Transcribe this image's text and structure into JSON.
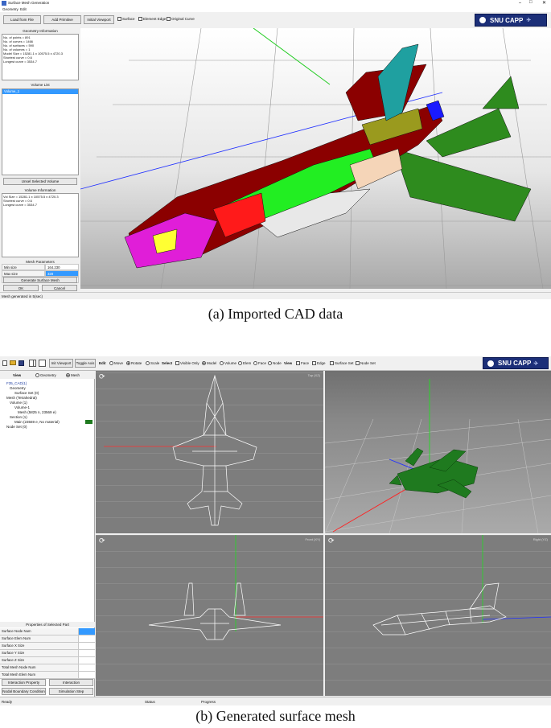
{
  "top": {
    "window_title": "Surface Mesh Generation",
    "menu": [
      "Geometry",
      "Edit"
    ],
    "window_controls": [
      "–",
      "□",
      "✕"
    ],
    "toolbar": {
      "load_file": "Load from File",
      "add_primitive": "Add Primitive",
      "initial_viewport": "Initial Viewport",
      "surface": "Surface",
      "element_edge": "Element Edge",
      "original_curve": "Original Curve"
    },
    "geometry_info": {
      "title": "Geometry Information",
      "lines": [
        "No. of points = 891",
        "No. of curves = 1466",
        "No. of surfaces = 590",
        "No. of volumes = 1",
        "Model Size = 15281.1 x 10575.5 x 4720.3",
        "Shortest curve = 0.6",
        "Longest curve = 3534.7"
      ]
    },
    "volume_list": {
      "title": "Volume List",
      "items": [
        "Volume_1"
      ]
    },
    "unselect_button": "Unsel Selected Volume",
    "volume_info": {
      "title": "Volume Information",
      "lines": [
        "Vol Size = 15281.1 x 10575.5 x 4720.3",
        "Shortest curve = 0.6",
        "Longest curve = 3534.7"
      ]
    },
    "mesh_params": {
      "title": "Mesh Parameters",
      "rows": [
        {
          "label": "Min size",
          "value": "164.230"
        },
        {
          "label": "Max size",
          "value": "328"
        },
        {
          "label": "Curvature",
          "value": "8"
        }
      ]
    },
    "generate_button": "Generate Surface Mesh",
    "ok_button": "OK",
    "cancel_button": "Cancel",
    "status": "Mesh generated in 5(sec)",
    "logo_text": "SNU CAPP",
    "caption": "(a) Imported CAD data"
  },
  "bottom": {
    "toolbar": {
      "init_viewport": "Init Viewport",
      "toggle_axis": "Toggle Axis",
      "edit": "Edit",
      "move": "Move",
      "rotate": "Rotate",
      "scale": "Scale",
      "select": "Select",
      "visible_only": "Visible Only",
      "model": "Model",
      "volume": "Volume",
      "elem": "Elem",
      "face": "Face",
      "node": "Node",
      "view": "View",
      "view_face": "Face",
      "view_edge": "Edge",
      "surface_set": "Surface Set",
      "node_set": "Node Set"
    },
    "view_switch": {
      "label": "View",
      "geometry": "Geometry",
      "mesh": "Mesh"
    },
    "tree": [
      "F35_CAD(1)",
      "Geometry",
      "Surface Set (0)",
      "Mesh (Tetrahedral)",
      "Volume (1)",
      "Volume-1",
      "Mesh (5825 n, 23569 e)",
      "Section (1)",
      "Main (23569 e, No material)",
      "Node Set (0)"
    ],
    "properties": {
      "title": "Properties of Selected Part",
      "rows": [
        "Surface Node Num",
        "Surface Elem Num",
        "Surface X Size",
        "Surface Y Size",
        "Surface Z Size",
        "Total Mesh Node Num",
        "Total Mesh Elem Num"
      ]
    },
    "buttons": {
      "interaction_property": "Interaction Property",
      "interaction": "Interaction",
      "nodal_bc": "Nodal Boundary Condition",
      "simulation_step": "Simulation Step"
    },
    "viewports": {
      "top": "Top (XZ)",
      "persp": "",
      "front": "Front (XY)",
      "right": "Right (YZ)"
    },
    "status": {
      "ready": "Ready",
      "status": "Status",
      "progress": "Progress"
    },
    "logo_text": "SNU CAPP",
    "caption": "(b) Generated surface mesh"
  },
  "colors": {
    "accent_blue": "#3399ff",
    "logo_navy": "#1c2f78",
    "viewport_grey": "#7d7d7d",
    "mesh_green": "#1f7a1f"
  }
}
